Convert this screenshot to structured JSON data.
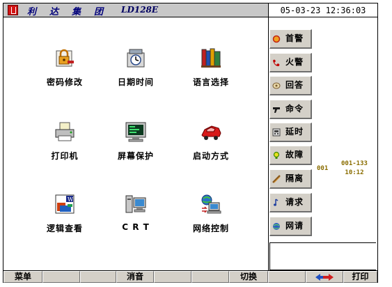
{
  "header": {
    "brand_chars": [
      "利",
      "达",
      "集",
      "团"
    ],
    "model": "LD128E",
    "datetime": "05-03-23 12:36:03"
  },
  "menu": [
    {
      "label": "密码修改",
      "icon": "lock-key-icon"
    },
    {
      "label": "日期时间",
      "icon": "clock-icon"
    },
    {
      "label": "语言选择",
      "icon": "books-icon"
    },
    {
      "label": "打印机",
      "icon": "printer-icon"
    },
    {
      "label": "屏幕保护",
      "icon": "monitor-icon"
    },
    {
      "label": "启动方式",
      "icon": "car-icon"
    },
    {
      "label": "逻辑查看",
      "icon": "document-icon"
    },
    {
      "label": "C R T",
      "icon": "computer-icon"
    },
    {
      "label": "网络控制",
      "icon": "network-icon"
    }
  ],
  "side_buttons": [
    {
      "label": "首警",
      "icon": "first-alarm-icon",
      "color": "#d23b1e"
    },
    {
      "label": "火警",
      "icon": "fire-phone-icon",
      "color": "#c00000"
    },
    {
      "label": "回答",
      "icon": "answer-icon",
      "color": "#7a5b30"
    },
    {
      "label": "命令",
      "icon": "command-icon",
      "color": "#1a1a1a"
    },
    {
      "label": "延时",
      "icon": "delay-icon",
      "color": "#5a5a5a"
    },
    {
      "label": "故障",
      "icon": "fault-bulb-icon",
      "color": "#3c8a00"
    },
    {
      "label": "隔离",
      "icon": "isolate-icon",
      "color": "#8a5a1e"
    },
    {
      "label": "请求",
      "icon": "request-note-icon",
      "color": "#2040a0"
    },
    {
      "label": "网请",
      "icon": "network-request-icon",
      "color": "#3060c0"
    }
  ],
  "isolation": {
    "count": "001",
    "range": "001-133",
    "time": "10:12"
  },
  "bottom_bar": {
    "menu_label": "菜单",
    "mute_label": "消音",
    "switch_label": "切换",
    "print_label": "打印"
  }
}
